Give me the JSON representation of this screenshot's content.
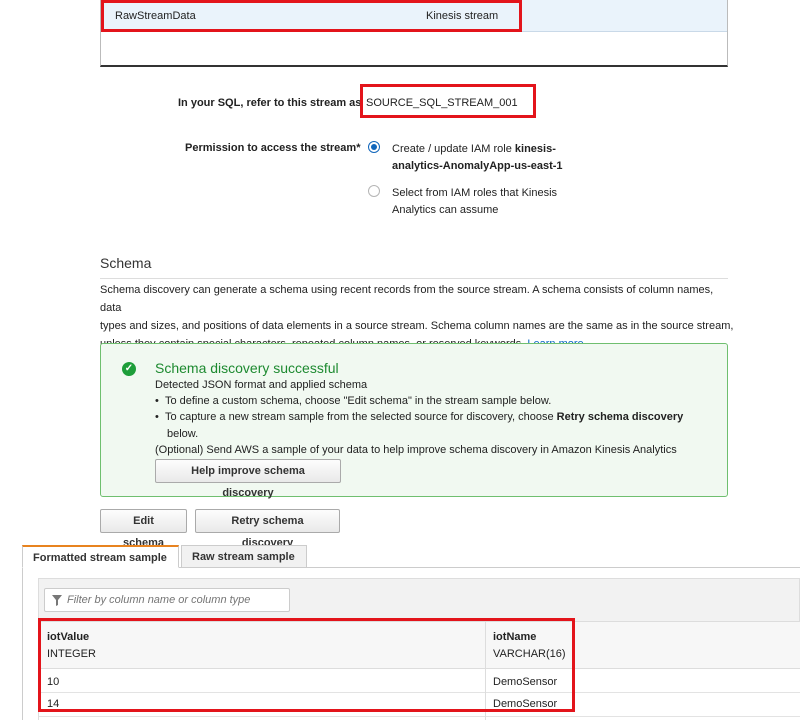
{
  "source_table": {
    "stream_name": "RawStreamData",
    "stream_type": "Kinesis stream"
  },
  "stream_ref": {
    "label": "In your SQL, refer to this stream as",
    "value": "SOURCE_SQL_STREAM_001"
  },
  "permission": {
    "label": "Permission to access the stream*",
    "option1_prefix": "Create / update IAM role ",
    "option1_bold_line1": "kinesis-",
    "option1_bold_line2": "analytics-AnomalyApp-us-east-1",
    "option1_selected": true,
    "option2_line1": "Select from IAM roles that Kinesis",
    "option2_line2": "Analytics can assume"
  },
  "schema": {
    "title": "Schema",
    "desc_line1": "Schema discovery can generate a schema using recent records from the source stream. A schema consists of column names, data",
    "desc_line2": "types and sizes, and positions of data elements in a source stream. Schema column names are the same as in the source stream,",
    "desc_line3": "unless they contain special characters, repeated column names, or reserved keywords.",
    "learn_more": "Learn more"
  },
  "success": {
    "title": "Schema discovery successful",
    "line1": "Detected JSON format and applied schema",
    "bullet1": "To define a custom schema, choose \"Edit schema\" in the stream sample below.",
    "bullet2_prefix": "To capture a new stream sample from the selected source for discovery, choose ",
    "bullet2_bold": "Retry schema discovery",
    "bullet2_cont": "below.",
    "optional": "(Optional) Send AWS a sample of your data to help improve schema discovery in Amazon Kinesis Analytics",
    "help_button": "Help improve schema discovery"
  },
  "actions": {
    "edit_schema": "Edit schema",
    "retry": "Retry schema discovery"
  },
  "tabs": [
    {
      "label": "Formatted stream sample",
      "active": true
    },
    {
      "label": "Raw stream sample",
      "active": false
    }
  ],
  "filter": {
    "placeholder": "Filter by column name or column type"
  },
  "columns": [
    {
      "name": "iotValue",
      "type": "INTEGER"
    },
    {
      "name": "iotName",
      "type": "VARCHAR(16)"
    }
  ],
  "rows": [
    [
      "10",
      "DemoSensor"
    ],
    [
      "14",
      "DemoSensor"
    ]
  ],
  "colors": {
    "highlight_red": "#e3141b",
    "success_green": "#1d8a30",
    "link_blue": "#0a66c2",
    "tab_accent": "#e8831f"
  }
}
